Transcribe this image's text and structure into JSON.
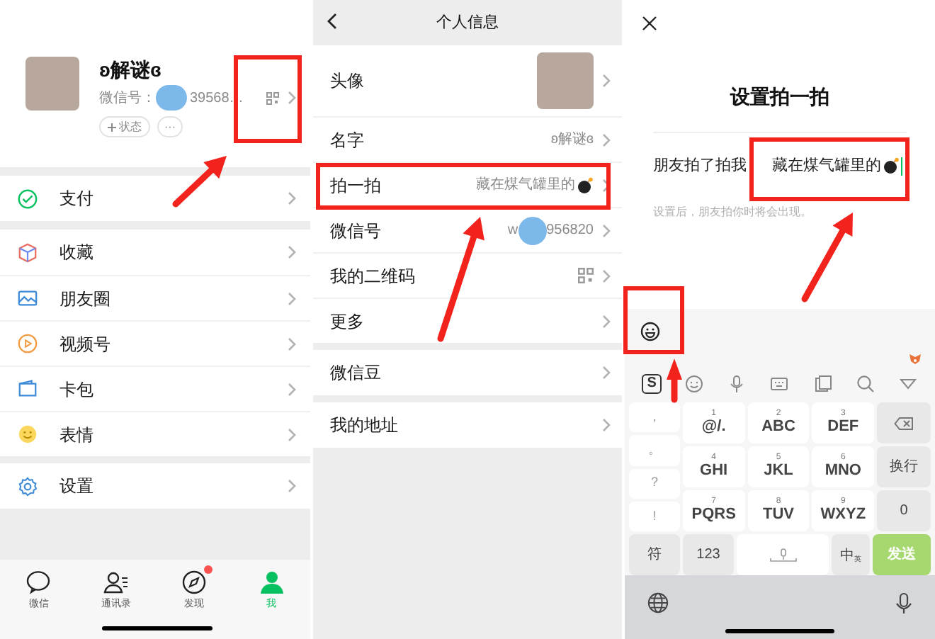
{
  "me_screen": {
    "name": "ʚ解谜ɞ",
    "id_label": "微信号：",
    "id_value": "39568…",
    "status_chip": "状态",
    "more_chip": "···",
    "groups": [
      [
        {
          "kind": "pay",
          "label": "支付"
        }
      ],
      [
        {
          "kind": "favorites",
          "label": "收藏"
        },
        {
          "kind": "moments",
          "label": "朋友圈"
        },
        {
          "kind": "channels",
          "label": "视频号"
        },
        {
          "kind": "cards",
          "label": "卡包"
        },
        {
          "kind": "stickers",
          "label": "表情"
        }
      ],
      [
        {
          "kind": "settings",
          "label": "设置"
        }
      ]
    ],
    "tabs": [
      {
        "kind": "chats",
        "label": "微信",
        "selected": false,
        "badge": false
      },
      {
        "kind": "contacts",
        "label": "通讯录",
        "selected": false,
        "badge": false
      },
      {
        "kind": "discover",
        "label": "发现",
        "selected": false,
        "badge": true
      },
      {
        "kind": "me",
        "label": "我",
        "selected": true,
        "badge": false
      }
    ]
  },
  "profile_screen": {
    "title": "个人信息",
    "groups": [
      [
        {
          "kind": "avatar",
          "label": "头像"
        },
        {
          "kind": "text",
          "label": "名字",
          "value": "ʚ解谜ɞ"
        },
        {
          "kind": "text",
          "label": "拍一拍",
          "value": "藏在煤气罐里的",
          "bomb": true
        },
        {
          "kind": "masked",
          "label": "微信号",
          "prefix": "w",
          "value": "956820"
        },
        {
          "kind": "qr",
          "label": "我的二维码"
        },
        {
          "kind": "plain",
          "label": "更多"
        }
      ],
      [
        {
          "kind": "plain",
          "label": "微信豆"
        }
      ],
      [
        {
          "kind": "plain",
          "label": "我的地址"
        }
      ]
    ]
  },
  "pat_screen": {
    "title": "设置拍一拍",
    "label": "朋友拍了拍我",
    "value": "藏在煤气罐里的",
    "bomb": true,
    "hint": "设置后，朋友拍你时将会出现。",
    "keyboard": {
      "logo_letter": "S",
      "punctuation": [
        "，",
        "。",
        "?",
        "!"
      ],
      "keys": [
        {
          "digit": "1",
          "letters": "@/."
        },
        {
          "digit": "2",
          "letters": "ABC"
        },
        {
          "digit": "3",
          "letters": "DEF"
        },
        {
          "digit": "4",
          "letters": "GHI"
        },
        {
          "digit": "5",
          "letters": "JKL"
        },
        {
          "digit": "6",
          "letters": "MNO"
        },
        {
          "digit": "7",
          "letters": "PQRS"
        },
        {
          "digit": "8",
          "letters": "TUV"
        },
        {
          "digit": "9",
          "letters": "WXYZ"
        }
      ],
      "side_keys": [
        {
          "kind": "backspace"
        },
        {
          "kind": "text",
          "label": "换行"
        },
        {
          "kind": "text",
          "label": "0"
        }
      ],
      "bottom_keys": [
        {
          "kind": "text",
          "label": "符"
        },
        {
          "kind": "text",
          "label": "123"
        },
        {
          "kind": "space"
        },
        {
          "kind": "lang",
          "label": "中",
          "sub": "英"
        },
        {
          "kind": "send",
          "label": "发送"
        }
      ]
    }
  }
}
